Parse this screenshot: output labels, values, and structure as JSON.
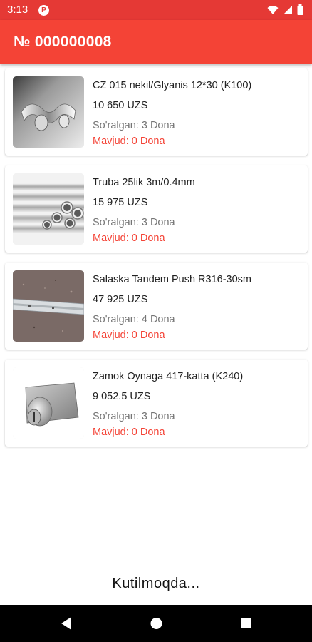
{
  "status_bar": {
    "time": "3:13",
    "app_icon": "P",
    "icons": [
      "wifi-icon",
      "signal-icon",
      "battery-icon"
    ]
  },
  "header": {
    "title": "№ 000000008"
  },
  "colors": {
    "accent": "#f44336",
    "status_bar": "#e53935",
    "stock_text": "#f44336",
    "sold_text": "#757575"
  },
  "items": [
    {
      "name": "CZ 015 nekil/Glyanis 12*30 (K100)",
      "price": "10 650 UZS",
      "sold": "So'ralgan: 3 Dona",
      "stock": "Mavjud: 0 Dona",
      "image_icon": "chrome-handle-image"
    },
    {
      "name": "Truba 25lik 3m/0.4mm",
      "price": "15 975 UZS",
      "sold": "So'ralgan: 3 Dona",
      "stock": "Mavjud: 0 Dona",
      "image_icon": "steel-pipes-image"
    },
    {
      "name": "Salaska Tandem Push R316-30sm",
      "price": "47 925 UZS",
      "sold": "So'ralgan: 4 Dona",
      "stock": "Mavjud: 0 Dona",
      "image_icon": "drawer-slide-image"
    },
    {
      "name": "Zamok Oynaga 417-katta (K240)",
      "price": "9 052.5 UZS",
      "sold": "So'ralgan: 3 Dona",
      "stock": "Mavjud: 0 Dona",
      "image_icon": "glass-lock-image"
    }
  ],
  "footer": {
    "loading_text": "Kutilmoqda..."
  },
  "nav": {
    "buttons": [
      "back-icon",
      "home-icon",
      "recents-icon"
    ]
  }
}
